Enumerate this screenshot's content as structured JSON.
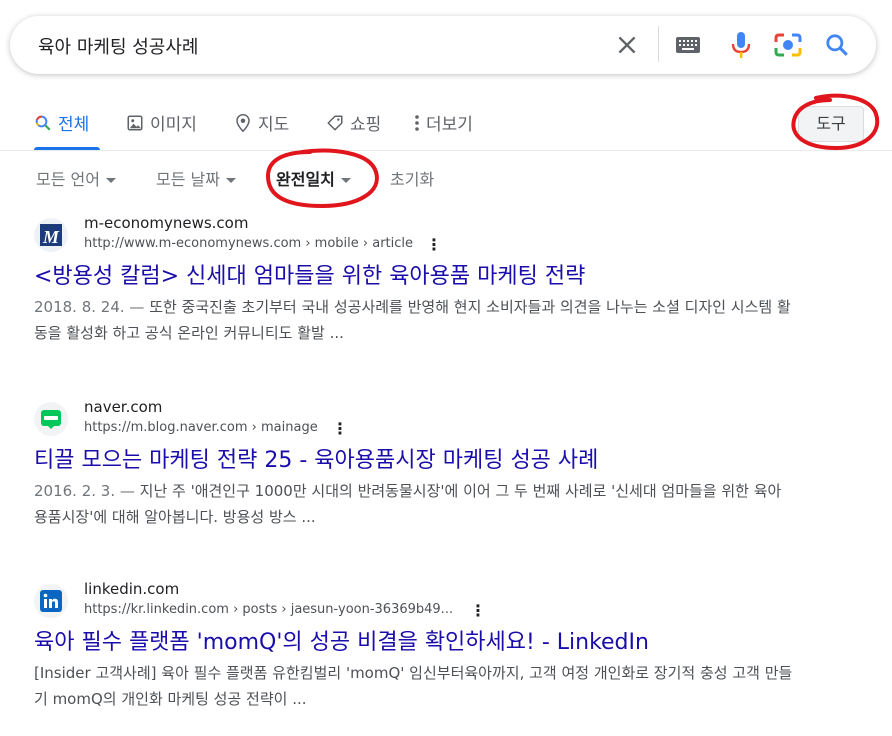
{
  "search": {
    "query": "육아 마케팅 성공사례"
  },
  "tabs": [
    {
      "label": "전체",
      "icon": "search-icon",
      "active": true
    },
    {
      "label": "이미지",
      "icon": "image-icon"
    },
    {
      "label": "지도",
      "icon": "map-pin-icon"
    },
    {
      "label": "쇼핑",
      "icon": "tag-icon"
    },
    {
      "label": "더보기",
      "icon": "more-vert-icon"
    }
  ],
  "tools_label": "도구",
  "filters": [
    {
      "label": "모든 언어"
    },
    {
      "label": "모든 날짜"
    },
    {
      "label": "완전일치"
    },
    {
      "label": "초기화"
    }
  ],
  "results": [
    {
      "site": "m-economynews.com",
      "url": "http://www.m-economynews.com › mobile › article",
      "title": "<방용성 칼럼> 신세대 엄마들을 위한 육아용품 마케팅 전략",
      "snippet_date": "2018. 8. 24. — ",
      "snippet": "또한 중국진출 초기부터 국내 성공사례를 반영해 현지 소비자들과 의견을 나누는 소셜 디자인 시스템 활동을 활성화 하고 공식 온라인 커뮤니티도 활발 ...",
      "favicon_icon": "m-economynews-logo-icon"
    },
    {
      "site": "naver.com",
      "url": "https://m.blog.naver.com › mainage",
      "title": "티끌 모으는 마케팅 전략 25 - 육아용품시장 마케팅 성공 사례",
      "snippet_date": "2016. 2. 3. — ",
      "snippet": "지난 주 '애견인구 1000만 시대의 반려동물시장'에 이어 그 두 번째 사례로 '신세대 엄마들을 위한 육아용품시장'에 대해 알아봅니다. 방용성 방스 ...",
      "favicon_icon": "naver-blog-logo-icon"
    },
    {
      "site": "linkedin.com",
      "url": "https://kr.linkedin.com › posts › jaesun-yoon-36369b49...",
      "title": "육아 필수 플랫폼 'momQ'의 성공 비결을 확인하세요! - LinkedIn",
      "snippet_date": "",
      "snippet": "[Insider 고객사례] 육아 필수 플랫폼 유한킴벌리 'momQ' 임신부터육아까지, 고객 여정 개인화로 장기적 충성 고객 만들기 momQ의 개인화 마케팅 성공 전략이 ...",
      "favicon_icon": "linkedin-logo-icon"
    }
  ],
  "colors": {
    "link": "#1a0dab",
    "accent": "#1a73e8",
    "annotation": "#e0161c"
  }
}
